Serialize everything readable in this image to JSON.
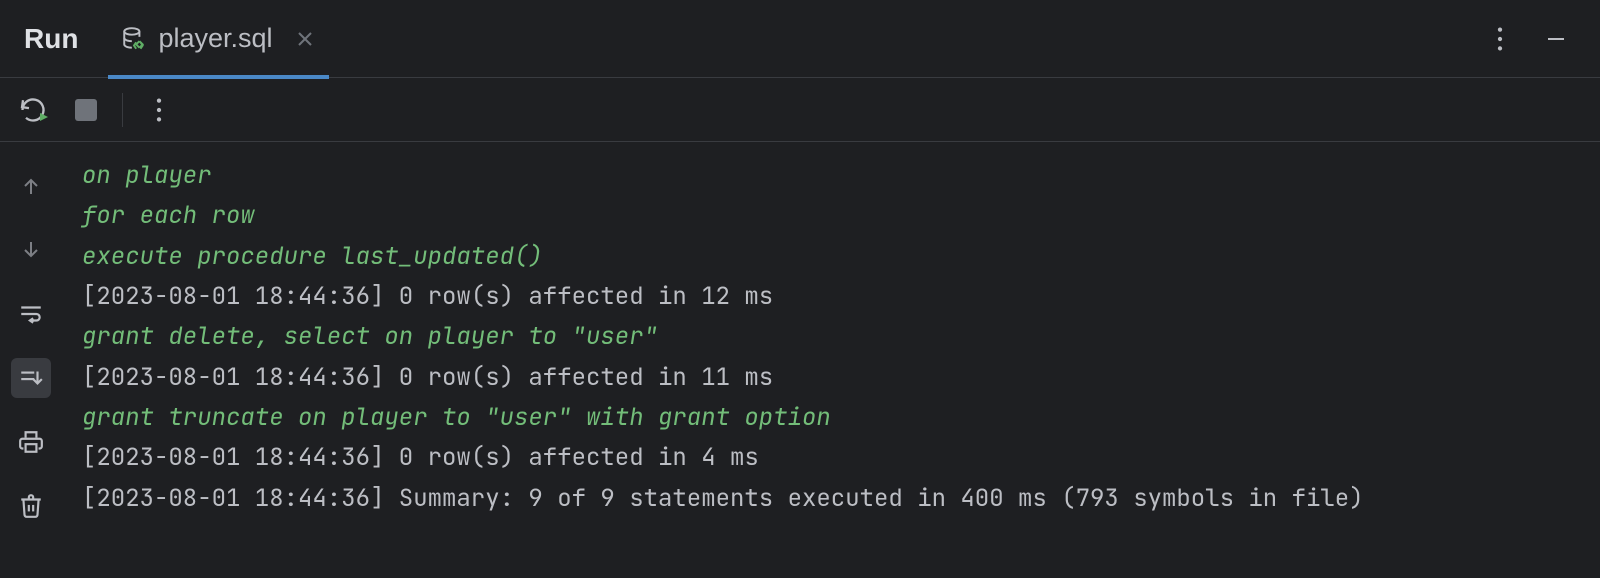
{
  "header": {
    "run_label": "Run",
    "tab": {
      "label": "player.sql"
    }
  },
  "console": {
    "lines": [
      {
        "type": "sql",
        "text": "on player"
      },
      {
        "type": "sql",
        "text": "for each row"
      },
      {
        "type": "sql",
        "text": "execute procedure last_updated()"
      },
      {
        "type": "log",
        "text": "[2023-08-01 18:44:36] 0 row(s) affected in 12 ms"
      },
      {
        "type": "sql",
        "text": "grant delete, select on player to \"user\""
      },
      {
        "type": "log",
        "text": "[2023-08-01 18:44:36] 0 row(s) affected in 11 ms"
      },
      {
        "type": "sql",
        "text": "grant truncate on player to \"user\" with grant option"
      },
      {
        "type": "log",
        "text": "[2023-08-01 18:44:36] 0 row(s) affected in 4 ms"
      },
      {
        "type": "log",
        "text": "[2023-08-01 18:44:36] Summary: 9 of 9 statements executed in 400 ms (793 symbols in file)"
      }
    ]
  }
}
